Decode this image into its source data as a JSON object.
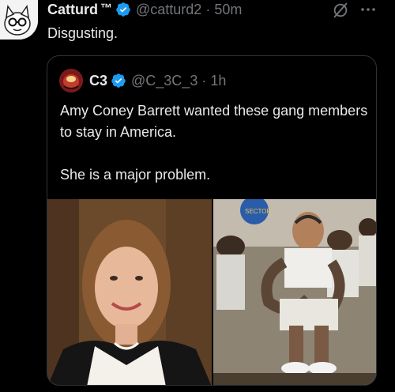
{
  "tweet": {
    "display_name": "Catturd",
    "tm": "™",
    "handle": "@catturd2",
    "separator": "·",
    "time": "50m",
    "text": "Disgusting."
  },
  "icons": {
    "avatar": "cat-avatar",
    "verified": "verified-badge-icon",
    "grok": "grok-icon",
    "more": "more-options-icon"
  },
  "quoted": {
    "display_name": "C3",
    "handle": "@C_3C_3",
    "separator": "·",
    "time": "1h",
    "text_lines": [
      "Amy Coney Barrett wanted these gang members to stay in America.",
      "She is a major problem."
    ],
    "media": {
      "image_1": "portrait-photo",
      "image_2": "prisoners-photo",
      "sign_text": "SECTOR"
    }
  },
  "colors": {
    "background": "#000000",
    "text": "#e7e9ea",
    "secondary": "#71767b",
    "border": "#2f3336",
    "verified": "#1d9bf0"
  }
}
